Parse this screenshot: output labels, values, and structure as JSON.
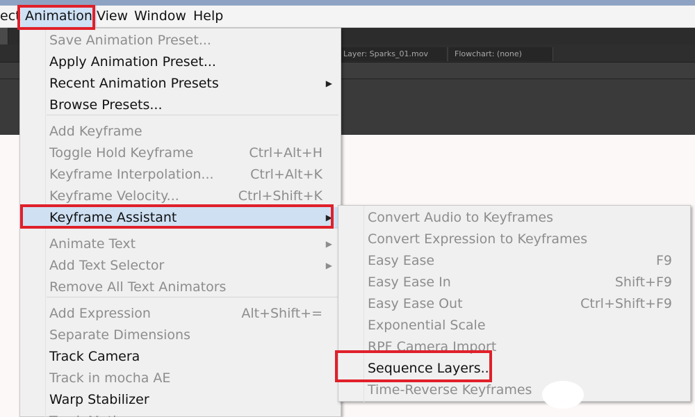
{
  "window": {
    "title_strip_color": "#8ea3c3"
  },
  "menubar": {
    "items": [
      {
        "label": "ect"
      },
      {
        "label": "Animation"
      },
      {
        "label": "View"
      },
      {
        "label": "Window"
      },
      {
        "label": "Help"
      }
    ]
  },
  "background": {
    "tabs": [
      {
        "label": "Layer: Sparks_01.mov"
      },
      {
        "label": "Flowchart: (none)"
      }
    ]
  },
  "animation_menu": {
    "groups": [
      [
        {
          "label": "Save Animation Preset...",
          "enabled": false
        },
        {
          "label": "Apply Animation Preset...",
          "enabled": true
        },
        {
          "label": "Recent Animation Presets",
          "enabled": true,
          "submenu": true
        },
        {
          "label": "Browse Presets...",
          "enabled": true
        }
      ],
      [
        {
          "label": "Add Keyframe",
          "enabled": false
        },
        {
          "label": "Toggle Hold Keyframe",
          "enabled": false,
          "shortcut": "Ctrl+Alt+H"
        },
        {
          "label": "Keyframe Interpolation...",
          "enabled": false,
          "shortcut": "Ctrl+Alt+K"
        },
        {
          "label": "Keyframe Velocity...",
          "enabled": false,
          "shortcut": "Ctrl+Shift+K"
        },
        {
          "label": "Keyframe Assistant",
          "enabled": true,
          "submenu": true,
          "highlighted": true
        }
      ],
      [
        {
          "label": "Animate Text",
          "enabled": false,
          "submenu": true
        },
        {
          "label": "Add Text Selector",
          "enabled": false,
          "submenu": true
        },
        {
          "label": "Remove All Text Animators",
          "enabled": false
        }
      ],
      [
        {
          "label": "Add Expression",
          "enabled": false,
          "shortcut": "Alt+Shift+="
        },
        {
          "label": "Separate Dimensions",
          "enabled": false
        },
        {
          "label": "Track Camera",
          "enabled": true
        },
        {
          "label": "Track in mocha AE",
          "enabled": false
        },
        {
          "label": "Warp Stabilizer",
          "enabled": true
        },
        {
          "label": "Track Motion",
          "enabled": false
        }
      ]
    ]
  },
  "keyframe_assistant_submenu": {
    "items": [
      {
        "label": "Convert Audio to Keyframes",
        "enabled": false
      },
      {
        "label": "Convert Expression to Keyframes",
        "enabled": false
      },
      {
        "label": "Easy Ease",
        "enabled": false,
        "shortcut": "F9"
      },
      {
        "label": "Easy Ease In",
        "enabled": false,
        "shortcut": "Shift+F9"
      },
      {
        "label": "Easy Ease Out",
        "enabled": false,
        "shortcut": "Ctrl+Shift+F9"
      },
      {
        "label": "Exponential Scale",
        "enabled": false
      },
      {
        "label": "RPF Camera Import",
        "enabled": false
      },
      {
        "label": "Sequence Layers...",
        "enabled": true
      },
      {
        "label": "Time-Reverse Keyframes",
        "enabled": false
      }
    ]
  },
  "highlight_color": "#e0202a",
  "submenu_arrow_glyph": "▶"
}
